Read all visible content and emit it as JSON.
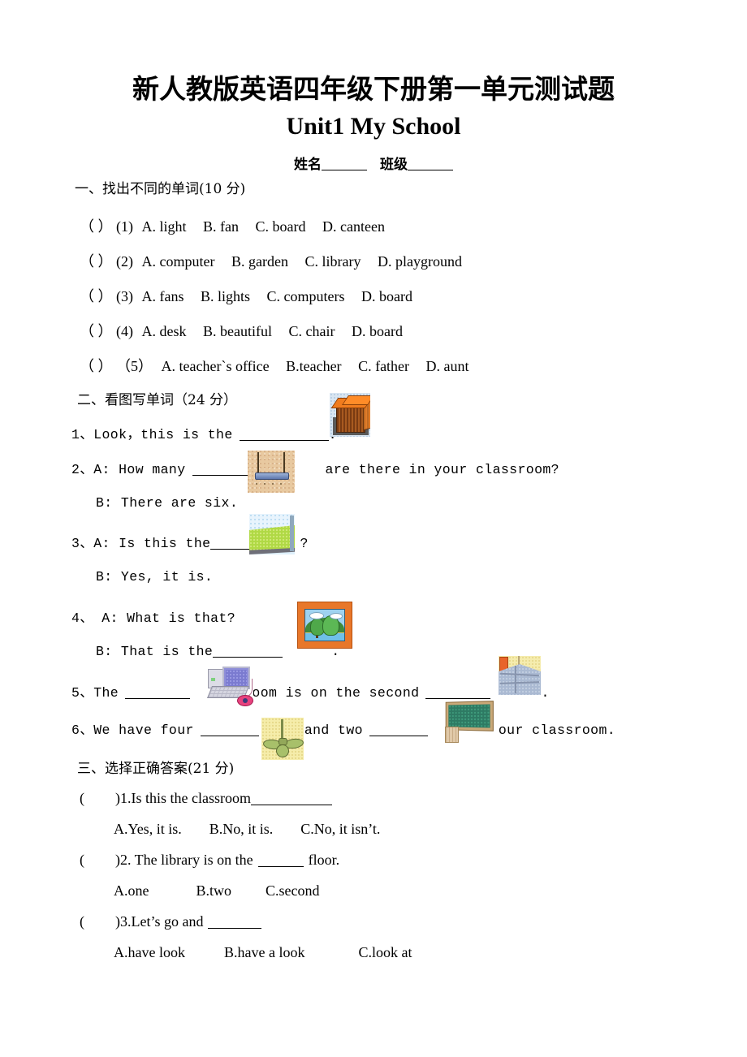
{
  "document": {
    "title_cn": "新人教版英语四年级下册第一单元测试题",
    "title_en": "Unit1 My School",
    "name_label": "姓名",
    "class_label": "班级"
  },
  "section1": {
    "heading": "一、找出不同的单词(10 分)",
    "items": [
      {
        "marker": "（ ）",
        "number": "(1)",
        "options": [
          "A. light",
          "B. fan",
          "C. board",
          "D. canteen"
        ]
      },
      {
        "marker": "（ ）",
        "number": "(2)",
        "options": [
          "A. computer",
          "B. garden",
          "C. library",
          "D. playground"
        ]
      },
      {
        "marker": "（ ）",
        "number": "(3)",
        "options": [
          "A. fans",
          "B. lights",
          "C. computers",
          "D. board"
        ]
      },
      {
        "marker": "（ ）",
        "number": "(4)",
        "options": [
          "A. desk",
          "B. beautiful",
          "C. chair",
          "D. board"
        ]
      },
      {
        "marker": "（  ）",
        "number": "（5）",
        "options": [
          "A. teacher`s office",
          "B.teacher",
          "C. father",
          "D. aunt"
        ]
      }
    ]
  },
  "section2": {
    "heading": "二、看图写单词（24 分）",
    "q1": {
      "number": "1、",
      "before": "Look，this is the",
      "after": "."
    },
    "q2": {
      "number": "2、",
      "line_a_before": "A: How many",
      "line_a_after": "are there in your classroom?",
      "line_b": "B: There are six."
    },
    "q3": {
      "number": "3、",
      "line_a_before": "A: Is this the",
      "line_a_after": "?",
      "line_b": "B: Yes, it is."
    },
    "q4": {
      "number": "4、",
      "line_a": "A: What is that?",
      "line_b_before": "B: That is the",
      "line_b_after": "."
    },
    "q5": {
      "number": "5、",
      "part1": "The",
      "part2": "room is on the second",
      "part3": "."
    },
    "q6": {
      "number": "6、",
      "part1": "We have four",
      "part2": "and two",
      "part3": "in our classroom."
    },
    "images": [
      {
        "name": "desk-image",
        "alt": "desk"
      },
      {
        "name": "light-image",
        "alt": "light"
      },
      {
        "name": "playground-image",
        "alt": "playground"
      },
      {
        "name": "picture-image",
        "alt": "picture"
      },
      {
        "name": "computer-image",
        "alt": "computer"
      },
      {
        "name": "floor-image",
        "alt": "floor"
      },
      {
        "name": "fan-image",
        "alt": "fan"
      },
      {
        "name": "blackboard-image",
        "alt": "board"
      }
    ]
  },
  "section3": {
    "heading": "三、选择正确答案(21 分)",
    "items": [
      {
        "marker": "(",
        "marker_close": ")",
        "stem": "1.Is this the classroom",
        "choices": [
          "A.Yes, it is.",
          "B.No, it is.",
          "C.No, it isn’t."
        ]
      },
      {
        "marker": "(",
        "marker_close": ")",
        "stem_before": "2. The library is on the",
        "stem_after": "floor.",
        "choices": [
          "A.one",
          "B.two",
          "C.second"
        ]
      },
      {
        "marker": "(",
        "marker_close": ")",
        "stem": "3.Let’s go and",
        "choices": [
          "A.have look",
          "B.have a look",
          "C.look at"
        ]
      }
    ]
  },
  "colors": {
    "page_background": "#ffffff",
    "text": "#000000",
    "desk_orange": "#f07c1e",
    "board_green": "#2e7a63",
    "fan_yellow": "#f5edaa",
    "field_green": "#b0d945"
  }
}
